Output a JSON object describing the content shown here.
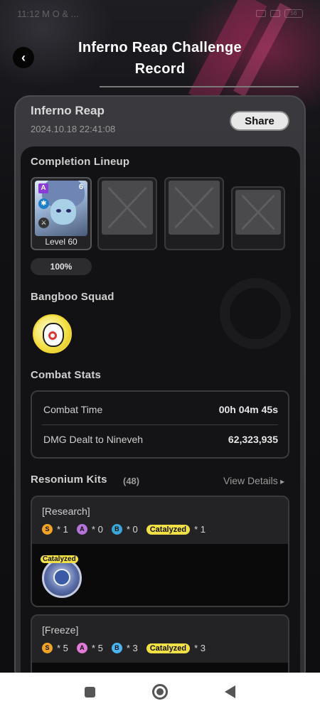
{
  "status_bar": {
    "time": "11:12 M O & ...",
    "battery": "56"
  },
  "header": {
    "title_line1": "Inferno Reap Challenge",
    "title_line2": "Record",
    "back_icon": "chevron-left-icon"
  },
  "record": {
    "mode_name": "Inferno Reap",
    "datetime": "2024.10.18 22:41:08",
    "share_label": "Share"
  },
  "lineup": {
    "title": "Completion Lineup",
    "agent": {
      "rank": "A",
      "mindscape": "6",
      "level_label": "Level 60"
    },
    "empty_slots": 3,
    "completion_percent": "100%"
  },
  "bangboo": {
    "title": "Bangboo Squad"
  },
  "combat_stats": {
    "title": "Combat Stats",
    "rows": [
      {
        "label": "Combat Time",
        "value": "00h 04m 45s"
      },
      {
        "label": "DMG Dealt to Nineveh",
        "value": "62,323,935"
      }
    ]
  },
  "resonium": {
    "title": "Resonium Kits",
    "count": "(48)",
    "view_details": "View Details",
    "kits": [
      {
        "name": "[Research]",
        "s": "* 1",
        "a": "* 0",
        "b": "* 0",
        "catalyzed_label": "Catalyzed",
        "catalyzed": "* 1",
        "item_tag": "Catalyzed"
      },
      {
        "name": "[Freeze]",
        "s": "* 5",
        "a": "* 5",
        "b": "* 3",
        "catalyzed_label": "Catalyzed",
        "catalyzed": "* 3"
      }
    ]
  },
  "grade_letters": {
    "s": "S",
    "a": "A",
    "b": "B"
  },
  "colors": {
    "accent_yellow": "#f1e045",
    "rank_purple": "#8a3bd8"
  }
}
